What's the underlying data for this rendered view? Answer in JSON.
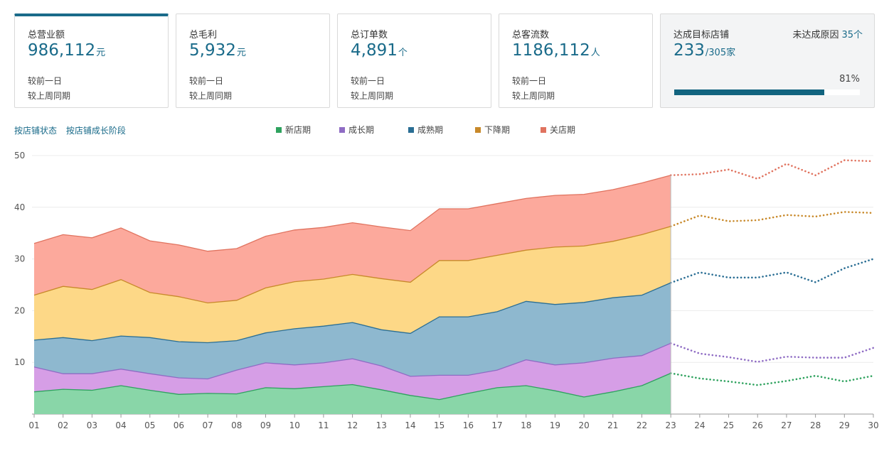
{
  "cards": [
    {
      "label": "总营业额",
      "value": "986,112",
      "unit": "元",
      "line1": "较前一日",
      "line2": "较上周同期"
    },
    {
      "label": "总毛利",
      "value": "5,932",
      "unit": "元",
      "line1": "较前一日",
      "line2": "较上周同期"
    },
    {
      "label": "总订单数",
      "value": "4,891",
      "unit": "个",
      "line1": "较前一日",
      "line2": "较上周同期"
    },
    {
      "label": "总客流数",
      "value": "1186,112",
      "unit": "人",
      "line1": "较前一日",
      "line2": "较上周同期"
    }
  ],
  "target_card": {
    "label": "达成目标店铺",
    "value": "233",
    "total": "/305家",
    "reason_label": "未达成原因",
    "reason_count": "35个",
    "percent_text": "81%",
    "progress": 0.81
  },
  "links": [
    "按店铺状态",
    "按店铺成长阶段"
  ],
  "colors": {
    "accent": "#1a6b8a"
  },
  "chart_data": {
    "type": "area",
    "stacked": true,
    "x": [
      "01",
      "02",
      "03",
      "04",
      "05",
      "06",
      "07",
      "08",
      "09",
      "10",
      "11",
      "12",
      "13",
      "14",
      "15",
      "16",
      "17",
      "18",
      "19",
      "20",
      "21",
      "22",
      "23",
      "24",
      "25",
      "26",
      "27",
      "28",
      "29",
      "30"
    ],
    "actual_through": "23",
    "forecast_style": "dotted",
    "ylim": [
      0,
      50
    ],
    "yticks": [
      10,
      20,
      30,
      40,
      50
    ],
    "grid": true,
    "legend_position": "top",
    "series": [
      {
        "name": "新店期",
        "color": "#2ea25e",
        "fill": "#89d6a8",
        "values": [
          4.3,
          4.8,
          4.6,
          5.5,
          4.6,
          3.8,
          4.0,
          3.9,
          5.1,
          4.9,
          5.3,
          5.7,
          4.7,
          3.6,
          2.8,
          4.0,
          5.1,
          5.5,
          4.5,
          3.3,
          4.3,
          5.5,
          7.9,
          6.9,
          6.3,
          5.6,
          6.4,
          7.4,
          6.3,
          7.4
        ]
      },
      {
        "name": "成长期",
        "color": "#8f6cc4",
        "fill": "#d69ee6",
        "values": [
          4.8,
          3.0,
          3.2,
          3.2,
          3.2,
          3.2,
          2.8,
          4.6,
          4.8,
          4.6,
          4.6,
          5.0,
          4.6,
          3.7,
          4.7,
          3.5,
          3.4,
          5.0,
          5.0,
          6.6,
          6.5,
          5.8,
          5.8,
          4.8,
          4.7,
          4.5,
          4.7,
          3.5,
          4.6,
          5.4
        ]
      },
      {
        "name": "成熟期",
        "color": "#2a6e94",
        "fill": "#8eb8cf",
        "values": [
          5.2,
          7.0,
          6.4,
          6.4,
          7.0,
          7.0,
          7.0,
          5.7,
          5.8,
          7.0,
          7.1,
          7.0,
          7.0,
          8.3,
          11.3,
          11.3,
          11.3,
          11.3,
          11.7,
          11.7,
          11.7,
          11.7,
          11.7,
          15.7,
          15.4,
          16.3,
          16.3,
          14.6,
          17.3,
          17.2
        ]
      },
      {
        "name": "下降期",
        "color": "#c8892a",
        "fill": "#fdd887",
        "values": [
          8.7,
          9.9,
          9.9,
          10.9,
          8.7,
          8.7,
          7.7,
          7.8,
          8.7,
          9.1,
          9.1,
          9.3,
          9.9,
          9.9,
          10.9,
          10.9,
          10.9,
          9.9,
          11.1,
          10.9,
          10.9,
          11.7,
          10.9,
          11.0,
          10.9,
          11.1,
          11.1,
          12.7,
          10.9,
          8.9
        ]
      },
      {
        "name": "关店期",
        "color": "#e0735f",
        "fill": "#fca99c",
        "values": [
          10.0,
          10.0,
          10.0,
          10.0,
          10.0,
          10.0,
          10.0,
          10.0,
          10.0,
          10.0,
          10.0,
          10.0,
          10.0,
          10.0,
          10.0,
          10.0,
          10.0,
          10.0,
          10.0,
          10.0,
          10.0,
          10.0,
          9.9,
          8.0,
          10.0,
          8.0,
          9.9,
          8.0,
          10.0,
          10.0
        ]
      }
    ]
  }
}
